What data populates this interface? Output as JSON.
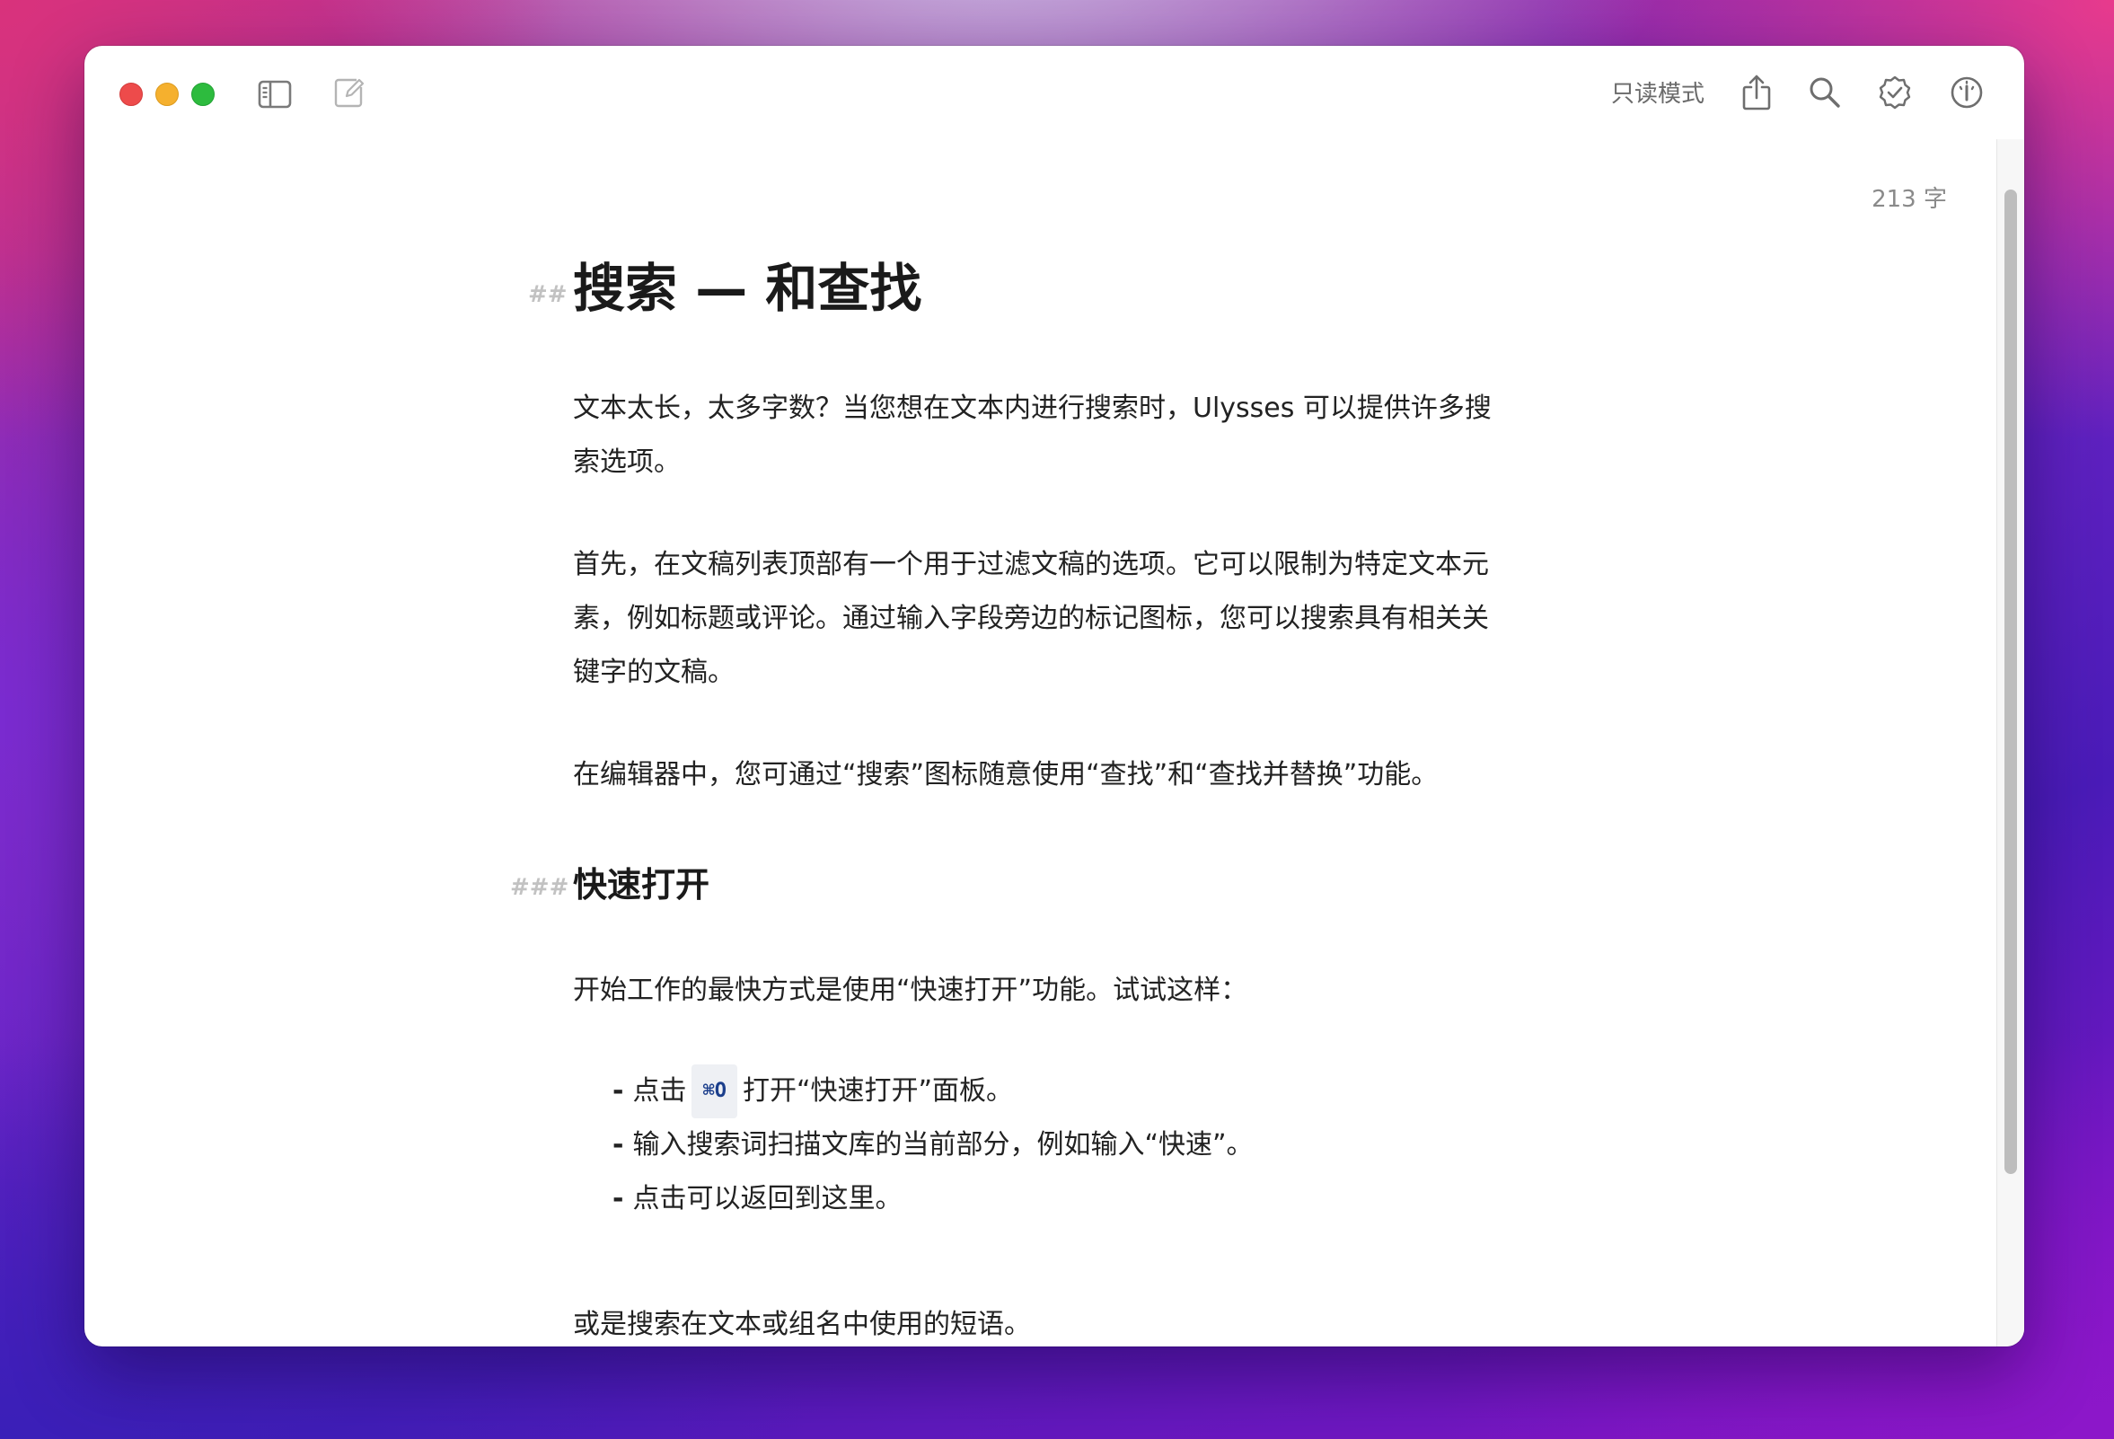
{
  "toolbar": {
    "read_mode_label": "只读模式",
    "icons": [
      "sidebar-toggle-icon",
      "compose-icon",
      "share-icon",
      "search-icon",
      "checkmark-badge-icon",
      "dashboard-icon"
    ]
  },
  "editor": {
    "word_count": "213 字",
    "h2_marker": "##",
    "title": "搜索 — 和查找",
    "paragraphs": [
      "文本太长，太多字数？当您想在文本内进行搜索时，Ulysses 可以提供许多搜索选项。",
      "首先，在文稿列表顶部有一个用于过滤文稿的选项。它可以限制为特定文本元素，例如标题或评论。通过输入字段旁边的标记图标，您可以搜索具有相关关键字的文稿。",
      "在编辑器中，您可通过“搜索”图标随意使用“查找”和“查找并替换”功能。"
    ],
    "h3_marker": "###",
    "subtitle": "快速打开",
    "intro": "开始工作的最快方式是使用“快速打开”功能。试试这样：",
    "list": {
      "bullet": "-",
      "item1_prefix": "点击",
      "item1_shortcut": "⌘O",
      "item1_suffix": "打开“快速打开”面板。",
      "item2": "输入搜索词扫描文库的当前部分，例如输入“快速”。",
      "item3": "点击可以返回到这里。"
    },
    "outro": "或是搜索在文本或组名中使用的短语。"
  },
  "colors": {
    "close": "#ed4b4b",
    "minimize": "#f5b02e",
    "maximize": "#2dbb3e",
    "markdown_marker": "#c2c2c2",
    "shortcut_text": "#1c3f8c",
    "shortcut_bg": "#eef0f4"
  }
}
